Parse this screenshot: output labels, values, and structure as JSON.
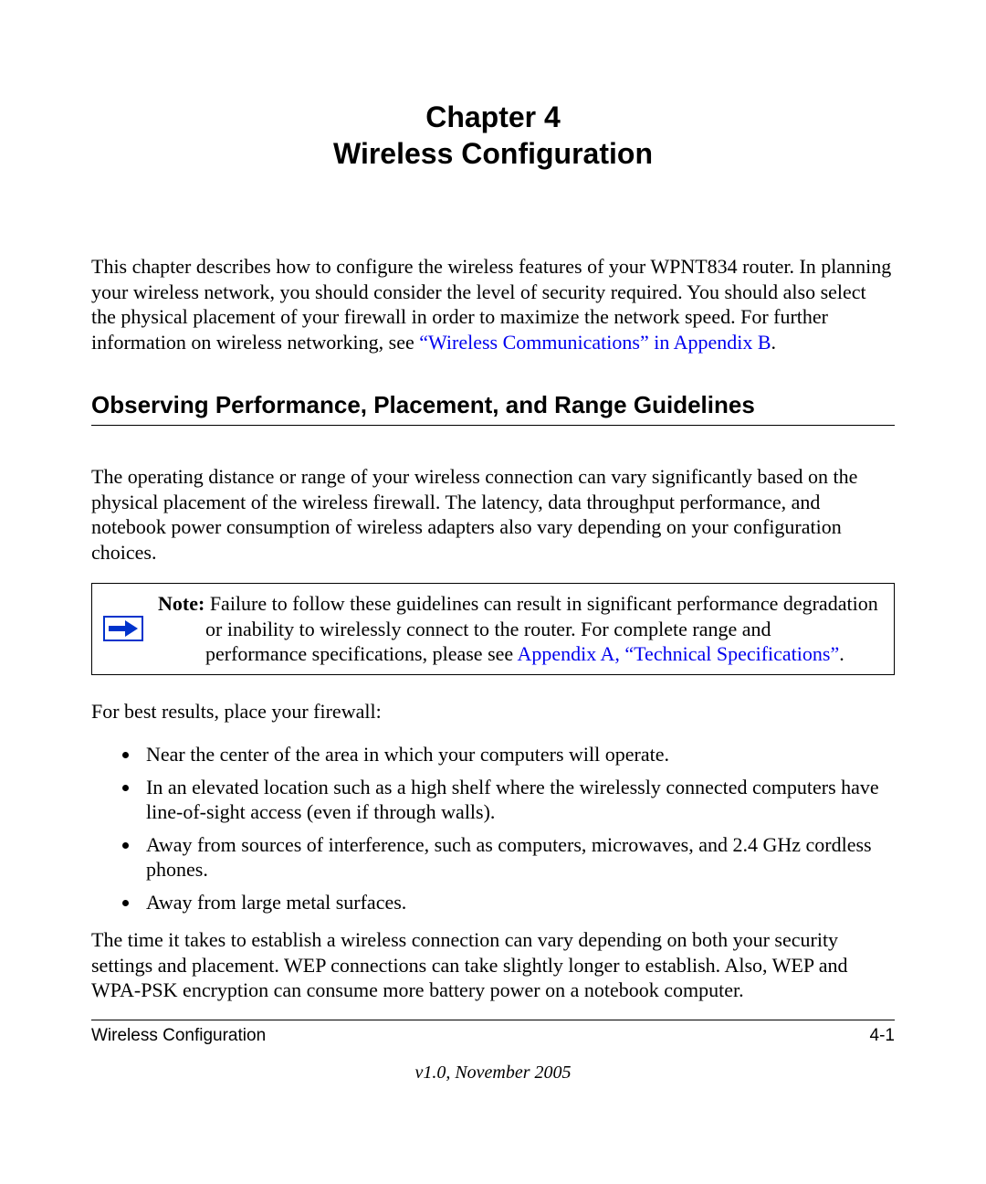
{
  "heading": {
    "chapter_number": "Chapter 4",
    "chapter_title": "Wireless Configuration"
  },
  "intro": {
    "text_before_link": "This chapter describes how to configure the wireless features of your WPNT834 router. In planning your wireless network, you should consider the level of security required. You should also select the physical placement of your firewall in order to maximize the network speed. For further information on wireless networking, see ",
    "link_text": "“Wireless Communications” in Appendix B",
    "text_after_link": "."
  },
  "section1": {
    "title": "Observing Performance, Placement, and Range Guidelines",
    "para1": "The operating distance or range of your wireless connection can vary significantly based on the physical placement of the wireless firewall. The latency, data throughput performance, and notebook power consumption of wireless adapters also vary depending on your configuration choices."
  },
  "note": {
    "label": "Note:",
    "line1_after_label": " Failure to follow these guidelines can result in significant performance degradation",
    "line2": "or inability to wirelessly connect to the router. For complete range and",
    "line3_before_link": "performance specifications, please see ",
    "link_text": "Appendix A, “Technical Specifications”",
    "line3_after_link": "."
  },
  "placement": {
    "lead": "For best results, place your firewall:",
    "bullets": [
      "Near the center of the area in which your computers will operate.",
      "In an elevated location such as a high shelf where the wirelessly connected computers have line-of-sight access (even if through walls).",
      "Away from sources of interference, such as computers, microwaves, and 2.4 GHz cordless phones.",
      "Away from large metal surfaces."
    ],
    "tail": "The time it takes to establish a wireless connection can vary depending on both your security settings and placement. WEP connections can take slightly longer to establish. Also, WEP and WPA-PSK encryption can consume more battery power on a notebook computer."
  },
  "footer": {
    "left": "Wireless Configuration",
    "right": "4-1",
    "version": "v1.0, November 2005"
  }
}
